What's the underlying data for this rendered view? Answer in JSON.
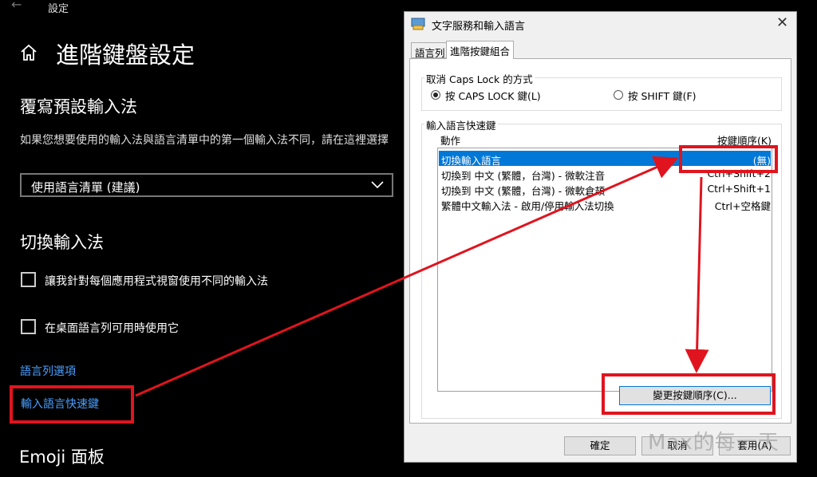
{
  "settings": {
    "back_icon": "back-arrow-icon",
    "top_label": "設定",
    "page_title": "進階鍵盤設定",
    "override_section": {
      "title": "覆寫預設輸入法",
      "description": "如果您想要使用的輸入法與語言清單中的第一個輸入法不同，請在這裡選擇",
      "dropdown_value": "使用語言清單 (建議)"
    },
    "switch_section": {
      "title": "切換輸入法",
      "checkbox1": "讓我針對每個應用程式視窗使用不同的輸入法",
      "checkbox2": "在桌面語言列可用時使用它",
      "link1": "語言列選項",
      "link2": "輸入語言快速鍵"
    },
    "emoji_section": {
      "title": "Emoji 面板"
    }
  },
  "dialog": {
    "title": "文字服務和輸入語言",
    "close": "✕",
    "tabs": [
      "語言列",
      "進階按鍵組合"
    ],
    "caps_group": {
      "title": "取消 Caps Lock 的方式",
      "option1": "按 CAPS LOCK 鍵(L)",
      "option2": "按 SHIFT 鍵(F)",
      "selected": "option1"
    },
    "hotkeys_group": {
      "title": "輸入語言快速鍵",
      "col_action": "動作",
      "col_key": "按鍵順序(K)",
      "rows": [
        {
          "action": "切換輸入語言",
          "key": "(無)"
        },
        {
          "action": "切換到 中文 (繁體，台灣) - 微軟注音",
          "key": "Ctrl+Shift+2"
        },
        {
          "action": "切換到 中文 (繁體，台灣) - 微軟倉頡",
          "key": "Ctrl+Shift+1"
        },
        {
          "action": "繁體中文輸入法 - 啟用/停用輸入法切換",
          "key": "Ctrl+空格鍵"
        }
      ],
      "change_button": "變更按鍵順序(C)..."
    },
    "buttons": {
      "ok": "確定",
      "cancel": "取消",
      "apply": "套用(A)"
    }
  },
  "watermark": "Max的每一天",
  "colors": {
    "highlight": "#e0141e",
    "selection": "#0078d7",
    "link": "#4aa0ff"
  }
}
